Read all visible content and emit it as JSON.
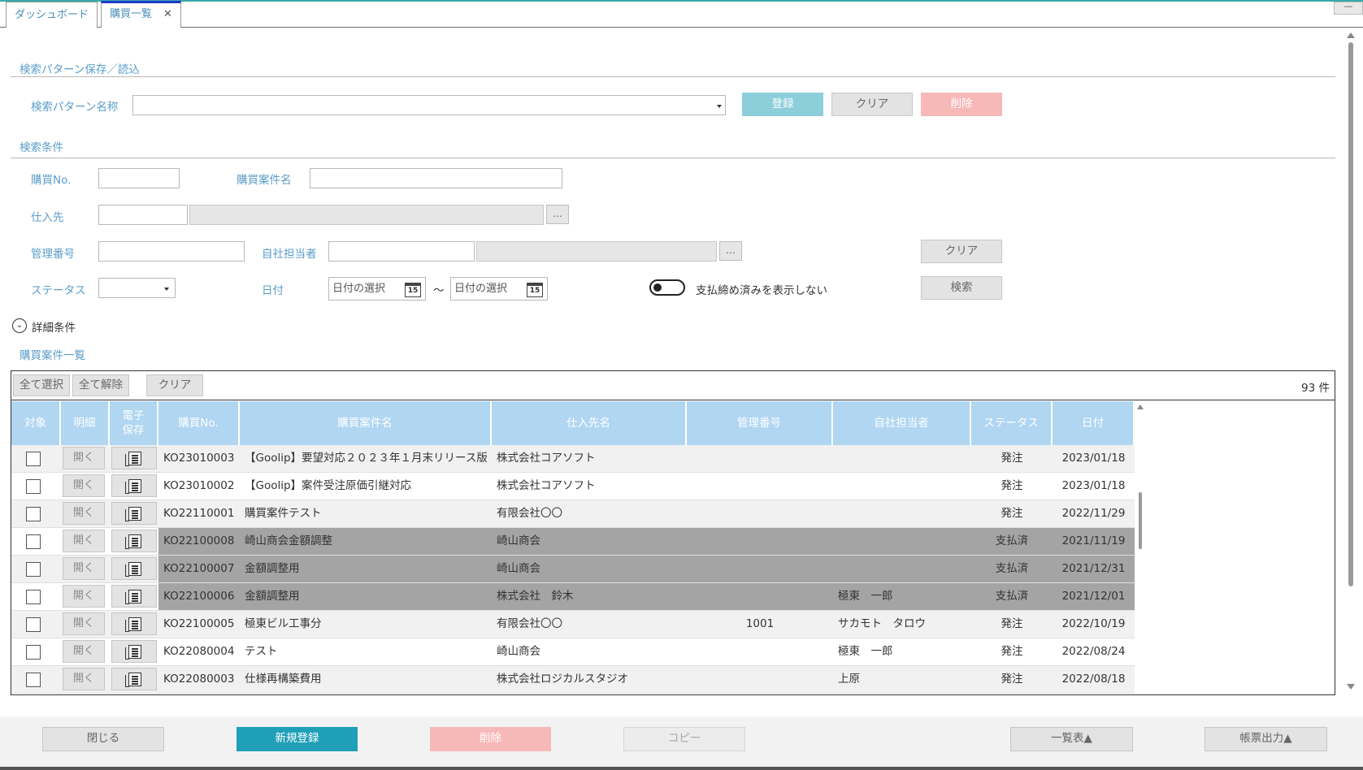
{
  "tabs": [
    {
      "label": "ダッシュボード"
    },
    {
      "label": "購買一覧",
      "close": "✕"
    }
  ],
  "window": {
    "minimize": "—"
  },
  "pattern": {
    "section_title": "検索パターン保存／読込",
    "name_label": "検索パターン名称",
    "name_value": "",
    "register": "登録",
    "clear": "クリア",
    "delete": "削除"
  },
  "conditions": {
    "section_title": "検索条件",
    "purchase_no_label": "購買No.",
    "purchase_no_value": "",
    "case_name_label": "購買案件名",
    "case_name_value": "",
    "supplier_label": "仕入先",
    "supplier_code": "",
    "supplier_name": "",
    "ellipsis": "…",
    "mgmt_no_label": "管理番号",
    "mgmt_no_value": "",
    "staff_label": "自社担当者",
    "staff_code": "",
    "staff_name": "",
    "status_label": "ステータス",
    "status_value": "",
    "date_label": "日付",
    "date_from_placeholder": "日付の選択",
    "date_to_placeholder": "日付の選択",
    "calendar_day": "15",
    "tilde": "～",
    "hide_paid_label": "支払締め済みを表示しない",
    "hide_paid_on": false,
    "clear": "クリア",
    "search": "検索",
    "detail_toggle": "詳細条件"
  },
  "list": {
    "section_title": "購買案件一覧",
    "select_all": "全て選択",
    "deselect_all": "全て解除",
    "clear": "クリア",
    "count": "93 件",
    "headers": {
      "target": "対象",
      "detail": "明細",
      "edoc_1": "電子",
      "edoc_2": "保存",
      "purchase_no": "購買No.",
      "case_name": "購買案件名",
      "supplier": "仕入先名",
      "mgmt_no": "管理番号",
      "staff": "自社担当者",
      "status": "ステータス",
      "date": "日付"
    },
    "open_label": "開く",
    "rows": [
      {
        "no": "KO23010003",
        "name": "【Goolip】要望対応２０２３年１月末リリース版",
        "supplier": "株式会社コアソフト",
        "mgmt": "",
        "staff": "",
        "status": "発注",
        "date": "2023/01/18"
      },
      {
        "no": "KO23010002",
        "name": "【Goolip】案件受注原価引継対応",
        "supplier": "株式会社コアソフト",
        "mgmt": "",
        "staff": "",
        "status": "発注",
        "date": "2023/01/18"
      },
      {
        "no": "KO22110001",
        "name": "購買案件テスト",
        "supplier": "有限会社〇〇",
        "mgmt": "",
        "staff": "",
        "status": "発注",
        "date": "2022/11/29"
      },
      {
        "no": "KO22100008",
        "name": "崎山商会金額調整",
        "supplier": "崎山商会",
        "mgmt": "",
        "staff": "",
        "status": "支払済",
        "date": "2021/11/19"
      },
      {
        "no": "KO22100007",
        "name": "金額調整用",
        "supplier": "崎山商会",
        "mgmt": "",
        "staff": "",
        "status": "支払済",
        "date": "2021/12/31"
      },
      {
        "no": "KO22100006",
        "name": "金額調整用",
        "supplier": "株式会社　鈴木",
        "mgmt": "",
        "staff": "極東　一郎",
        "status": "支払済",
        "date": "2021/12/01"
      },
      {
        "no": "KO22100005",
        "name": "極東ビル工事分",
        "supplier": "有限会社〇〇",
        "mgmt": "1001",
        "staff": "サカモト　タロウ",
        "status": "発注",
        "date": "2022/10/19"
      },
      {
        "no": "KO22080004",
        "name": "テスト",
        "supplier": "崎山商会",
        "mgmt": "",
        "staff": "極東　一郎",
        "status": "発注",
        "date": "2022/08/24"
      },
      {
        "no": "KO22080003",
        "name": "仕様再構築費用",
        "supplier": "株式会社ロジカルスタジオ",
        "mgmt": "",
        "staff": "上原",
        "status": "発注",
        "date": "2022/08/18"
      }
    ]
  },
  "footer": {
    "close": "閉じる",
    "new": "新規登録",
    "delete": "削除",
    "copy": "コピー",
    "list_table": "一覧表▲",
    "report_output": "帳票出力▲"
  },
  "colors": {
    "accent": "#1f9fb8",
    "header_bg": "#b0d6f2",
    "label": "#5a9cc8",
    "paid_row": "#a4a4a4",
    "danger_light": "#f7b8b8"
  }
}
